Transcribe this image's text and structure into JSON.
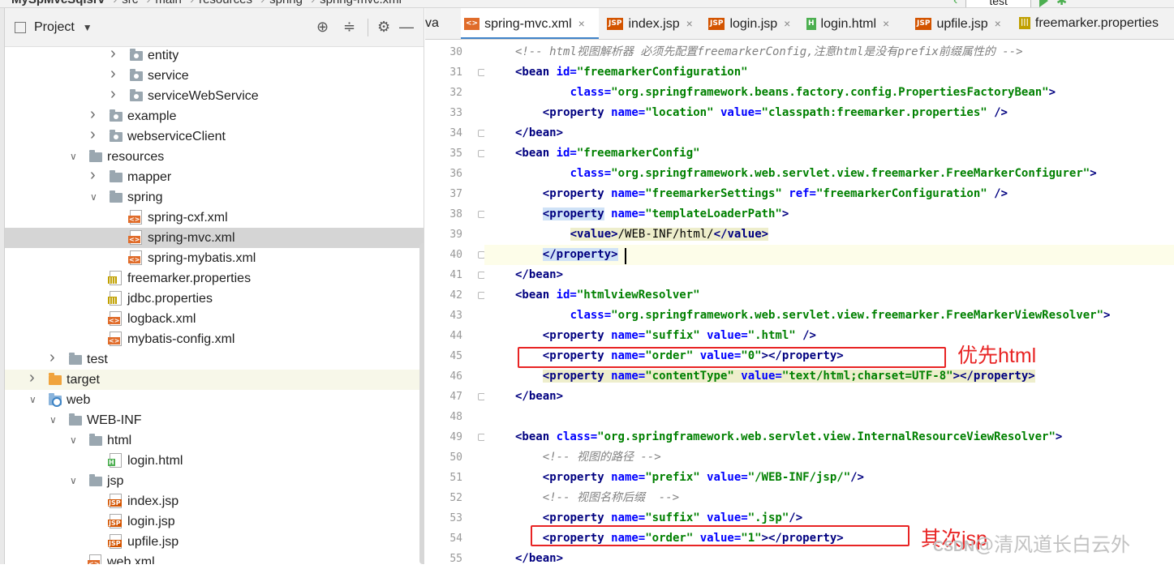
{
  "topbar": {
    "project_name": "MySpMvcSqlsrv",
    "crumbs": [
      "src",
      "main",
      "resources",
      "spring",
      "spring-mvc.xml"
    ],
    "run_config": "test"
  },
  "project_panel": {
    "title": "Project",
    "cut_tab": "va",
    "tree": [
      {
        "label": "entity",
        "icon": "package-folder",
        "depth": 5,
        "arrow": "right"
      },
      {
        "label": "service",
        "icon": "package-folder",
        "depth": 5,
        "arrow": "right"
      },
      {
        "label": "serviceWebService",
        "icon": "package-folder",
        "depth": 5,
        "arrow": "right"
      },
      {
        "label": "example",
        "icon": "package-folder",
        "depth": 4,
        "arrow": "right"
      },
      {
        "label": "webserviceClient",
        "icon": "package-folder",
        "depth": 4,
        "arrow": "right"
      },
      {
        "label": "resources",
        "icon": "resources-folder",
        "depth": 3,
        "arrow": "down"
      },
      {
        "label": "mapper",
        "icon": "folder",
        "depth": 4,
        "arrow": "right"
      },
      {
        "label": "spring",
        "icon": "folder",
        "depth": 4,
        "arrow": "down"
      },
      {
        "label": "spring-cxf.xml",
        "icon": "xml-file",
        "depth": 5,
        "arrow": ""
      },
      {
        "label": "spring-mvc.xml",
        "icon": "xml-file",
        "depth": 5,
        "arrow": "",
        "selected": true
      },
      {
        "label": "spring-mybatis.xml",
        "icon": "xml-file",
        "depth": 5,
        "arrow": ""
      },
      {
        "label": "freemarker.properties",
        "icon": "properties-file",
        "depth": 4,
        "arrow": ""
      },
      {
        "label": "jdbc.properties",
        "icon": "properties-file",
        "depth": 4,
        "arrow": ""
      },
      {
        "label": "logback.xml",
        "icon": "xml-file",
        "depth": 4,
        "arrow": ""
      },
      {
        "label": "mybatis-config.xml",
        "icon": "xml-file",
        "depth": 4,
        "arrow": ""
      },
      {
        "label": "test",
        "icon": "folder",
        "depth": 2,
        "arrow": "right"
      },
      {
        "label": "target",
        "icon": "orange-folder",
        "depth": 1,
        "arrow": "right",
        "highlight": true
      },
      {
        "label": "web",
        "icon": "web-folder",
        "depth": 1,
        "arrow": "down"
      },
      {
        "label": "WEB-INF",
        "icon": "folder",
        "depth": 2,
        "arrow": "down"
      },
      {
        "label": "html",
        "icon": "folder",
        "depth": 3,
        "arrow": "down"
      },
      {
        "label": "login.html",
        "icon": "html-file",
        "depth": 4,
        "arrow": ""
      },
      {
        "label": "jsp",
        "icon": "folder",
        "depth": 3,
        "arrow": "down"
      },
      {
        "label": "index.jsp",
        "icon": "jsp-file",
        "depth": 4,
        "arrow": ""
      },
      {
        "label": "login.jsp",
        "icon": "jsp-file",
        "depth": 4,
        "arrow": ""
      },
      {
        "label": "upfile.jsp",
        "icon": "jsp-file",
        "depth": 4,
        "arrow": ""
      },
      {
        "label": "web.xml",
        "icon": "xml-file",
        "depth": 3,
        "arrow": ""
      }
    ]
  },
  "editor_tabs": [
    {
      "label": "spring-mvc.xml",
      "icon": "xml-file",
      "active": true
    },
    {
      "label": "index.jsp",
      "icon": "jsp-file"
    },
    {
      "label": "login.jsp",
      "icon": "jsp-file"
    },
    {
      "label": "login.html",
      "icon": "html-file"
    },
    {
      "label": "upfile.jsp",
      "icon": "jsp-file"
    },
    {
      "label": "freemarker.properties",
      "icon": "properties-file"
    }
  ],
  "editor": {
    "lines": [
      {
        "n": "30",
        "ind": 4,
        "parts": [
          [
            "cm",
            "<!-- html视图解析器 必须先配置freemarkerConfig,注意html是没有prefix前缀属性的 -->"
          ]
        ]
      },
      {
        "n": "31",
        "ind": 4,
        "parts": [
          [
            "tg",
            "<bean "
          ],
          [
            "at",
            "id="
          ],
          [
            "st",
            "\"freemarkerConfiguration\""
          ]
        ]
      },
      {
        "n": "32",
        "ind": 12,
        "parts": [
          [
            "at",
            "class="
          ],
          [
            "st",
            "\"org.springframework.beans.factory.config.PropertiesFactoryBean\""
          ],
          [
            "tg",
            ">"
          ]
        ]
      },
      {
        "n": "33",
        "ind": 8,
        "parts": [
          [
            "tg",
            "<property "
          ],
          [
            "at",
            "name="
          ],
          [
            "st",
            "\"location\" "
          ],
          [
            "at",
            "value="
          ],
          [
            "st",
            "\"classpath:freemarker.properties\" "
          ],
          [
            "tg",
            "/>"
          ]
        ]
      },
      {
        "n": "34",
        "ind": 4,
        "parts": [
          [
            "tg",
            "</bean>"
          ]
        ]
      },
      {
        "n": "35",
        "ind": 4,
        "parts": [
          [
            "tg",
            "<bean "
          ],
          [
            "at",
            "id="
          ],
          [
            "st",
            "\"freemarkerConfig\""
          ]
        ]
      },
      {
        "n": "36",
        "ind": 12,
        "parts": [
          [
            "at",
            "class="
          ],
          [
            "st",
            "\"org.springframework.web.servlet.view.freemarker.FreeMarkerConfigurer\""
          ],
          [
            "tg",
            ">"
          ]
        ]
      },
      {
        "n": "37",
        "ind": 8,
        "parts": [
          [
            "tg",
            "<property "
          ],
          [
            "at",
            "name="
          ],
          [
            "st",
            "\"freemarkerSettings\" "
          ],
          [
            "at",
            "ref="
          ],
          [
            "st",
            "\"freemarkerConfiguration\" "
          ],
          [
            "tg",
            "/>"
          ]
        ]
      },
      {
        "n": "38",
        "ind": 8,
        "parts": [
          [
            "tg bgsel",
            "<property"
          ],
          [
            "tg",
            " "
          ],
          [
            "at",
            "name="
          ],
          [
            "st",
            "\"templateLoaderPath\""
          ],
          [
            "tg",
            ">"
          ]
        ]
      },
      {
        "n": "39",
        "ind": 12,
        "parts": [
          [
            "tg bgtag",
            "<value>"
          ],
          [
            "tx bgtag",
            "/WEB-INF/html/"
          ],
          [
            "tg bgtag",
            "</value>"
          ]
        ]
      },
      {
        "n": "40",
        "ind": 8,
        "parts": [
          [
            "tg bgsel",
            "</property>"
          ]
        ],
        "current": true
      },
      {
        "n": "41",
        "ind": 4,
        "parts": [
          [
            "tg",
            "</bean>"
          ]
        ]
      },
      {
        "n": "42",
        "ind": 4,
        "parts": [
          [
            "tg",
            "<bean "
          ],
          [
            "at",
            "id="
          ],
          [
            "st",
            "\"htmlviewResolver\""
          ]
        ]
      },
      {
        "n": "43",
        "ind": 12,
        "parts": [
          [
            "at",
            "class="
          ],
          [
            "st",
            "\"org.springframework.web.servlet.view.freemarker.FreeMarkerViewResolver\""
          ],
          [
            "tg",
            ">"
          ]
        ]
      },
      {
        "n": "44",
        "ind": 8,
        "parts": [
          [
            "tg",
            "<property "
          ],
          [
            "at",
            "name="
          ],
          [
            "st",
            "\"suffix\" "
          ],
          [
            "at",
            "value="
          ],
          [
            "st",
            "\".html\" "
          ],
          [
            "tg",
            "/>"
          ]
        ]
      },
      {
        "n": "45",
        "ind": 8,
        "parts": [
          [
            "tg",
            "<property "
          ],
          [
            "at",
            "name="
          ],
          [
            "st",
            "\"order\" "
          ],
          [
            "at",
            "value="
          ],
          [
            "st",
            "\"0\""
          ],
          [
            "tg",
            "></property>"
          ]
        ]
      },
      {
        "n": "46",
        "ind": 8,
        "parts": [
          [
            "tg bgtag",
            "<property "
          ],
          [
            "at bgtag",
            "name="
          ],
          [
            "st bgtag",
            "\"contentType\" "
          ],
          [
            "at bgtag",
            "value="
          ],
          [
            "st bgtag",
            "\"text/html;charset=UTF-8\""
          ],
          [
            "tg bgtag",
            "></property>"
          ]
        ]
      },
      {
        "n": "47",
        "ind": 4,
        "parts": [
          [
            "tg",
            "</bean>"
          ]
        ]
      },
      {
        "n": "48",
        "ind": 0,
        "parts": []
      },
      {
        "n": "49",
        "ind": 4,
        "parts": [
          [
            "tg",
            "<bean "
          ],
          [
            "at",
            "class="
          ],
          [
            "st",
            "\"org.springframework.web.servlet.view.InternalResourceViewResolver\""
          ],
          [
            "tg",
            ">"
          ]
        ]
      },
      {
        "n": "50",
        "ind": 8,
        "parts": [
          [
            "cm",
            "<!-- 视图的路径 -->"
          ]
        ]
      },
      {
        "n": "51",
        "ind": 8,
        "parts": [
          [
            "tg",
            "<property "
          ],
          [
            "at",
            "name="
          ],
          [
            "st",
            "\"prefix\" "
          ],
          [
            "at",
            "value="
          ],
          [
            "st",
            "\"/WEB-INF/jsp/\""
          ],
          [
            "tg",
            "/>"
          ]
        ]
      },
      {
        "n": "52",
        "ind": 8,
        "parts": [
          [
            "cm",
            "<!-- 视图名称后缀  -->"
          ]
        ]
      },
      {
        "n": "53",
        "ind": 8,
        "parts": [
          [
            "tg",
            "<property "
          ],
          [
            "at",
            "name="
          ],
          [
            "st",
            "\"suffix\" "
          ],
          [
            "at",
            "value="
          ],
          [
            "st",
            "\".jsp\""
          ],
          [
            "tg",
            "/>"
          ]
        ]
      },
      {
        "n": "54",
        "ind": 8,
        "parts": [
          [
            "tg",
            "<property "
          ],
          [
            "at",
            "name="
          ],
          [
            "st",
            "\"order\" "
          ],
          [
            "at",
            "value="
          ],
          [
            "st",
            "\"1\""
          ],
          [
            "tg",
            "></property>"
          ]
        ]
      },
      {
        "n": "55",
        "ind": 4,
        "parts": [
          [
            "tg",
            "</bean>"
          ]
        ]
      }
    ]
  },
  "annotations": {
    "note1": "优先html",
    "note2": "其次jsp"
  },
  "watermark": {
    "brand": "CSDN",
    "author": "@清风道长白云外"
  },
  "colors": {
    "accent": "#4083c9",
    "annotation_red": "#e82424",
    "tag": "#000080",
    "attr": "#0000ff",
    "string": "#008000",
    "comment": "#808080"
  }
}
